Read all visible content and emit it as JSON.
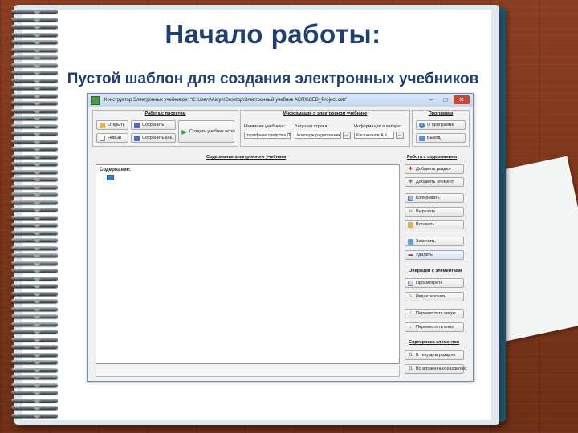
{
  "slide": {
    "title": "Начало работы:",
    "subtitle": "Пустой шаблон для создания электронных учебников"
  },
  "window": {
    "title": "Конструктор Электронных учебников: \"C:\\Users\\Aidyn\\Desktop\\Электронный учебник АСПК\\CEB_Project.ceb\"",
    "controls": {
      "minimize": "–",
      "maximize": "□",
      "close": "✕"
    }
  },
  "project_group": {
    "label": "Работа с проектом",
    "open": "Открыть",
    "save": "Сохранить",
    "new": "Новый",
    "save_as": "Сохранить как..",
    "create": "Создать учебник (exe)"
  },
  "info_group": {
    "label": "Информация о электронном учебнике",
    "name_label": "Название учебника:",
    "name_value": "тарифные средства ПК",
    "ticker_label": "Бегущая строка:",
    "ticker_value": "Колледж радиотехники",
    "author_label": "Информация о авторе:",
    "author_value": "Касенканов А.К.",
    "dots": "..."
  },
  "program_group": {
    "label": "Программа",
    "about": "О программе",
    "exit": "Выход"
  },
  "content": {
    "label": "Содержание электронного учебника",
    "root": "Содержание:"
  },
  "content_ops": {
    "label": "Работа с содержанием",
    "add_section": "Добавить раздел",
    "add_element": "Добавить элемент",
    "copy": "Копировать",
    "cut": "Вырезать",
    "paste": "Вставить",
    "replace": "Заменить",
    "delete": "Удалить"
  },
  "element_ops": {
    "label": "Операции с элементами",
    "view": "Просмотреть",
    "edit": "Редактировать",
    "move_up": "Переместить вверх",
    "move_down": "Переместить вниз"
  },
  "sort_ops": {
    "label": "Сортировка элементов",
    "current": "В текущем разделе",
    "nested": "Во вложенных разделах"
  }
}
